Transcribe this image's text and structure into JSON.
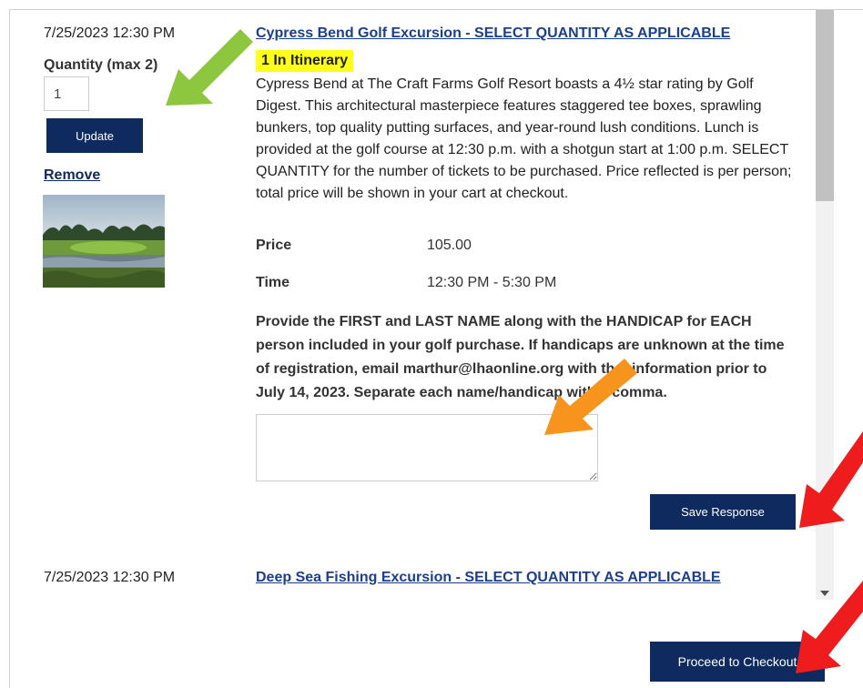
{
  "items": [
    {
      "datetime": "7/25/2023 12:30 PM",
      "quantity_label": "Quantity (max 2)",
      "quantity_value": "1",
      "update_label": "Update",
      "remove_label": "Remove",
      "title": "Cypress Bend Golf Excursion - SELECT QUANTITY AS APPLICABLE",
      "badge": "1 In Itinerary",
      "description": "Cypress Bend at The Craft Farms Golf Resort boasts a 4½ star rating by Golf Digest. This architectural masterpiece features staggered tee boxes, sprawling bunkers, top quality putting surfaces, and year-round lush conditions. Lunch is provided at the golf course at 12:30 p.m. with a shotgun start at 1:00 p.m. SELECT QUANTITY for the number of tickets to be purchased. Price reflected is per person; total price will be shown in your cart at checkout.",
      "price_label": "Price",
      "price_value": "105.00",
      "time_label": "Time",
      "time_value": "12:30 PM - 5:30 PM",
      "prompt": "Provide the FIRST and LAST NAME along with the HANDICAP for EACH person included in your golf purchase. If handicaps are unknown at the time of registration, email marthur@lhaonline.org with that information prior to July 14, 2023. Separate each name/handicap with a comma.",
      "response_value": "",
      "save_label": "Save Response"
    },
    {
      "datetime": "7/25/2023 12:30 PM",
      "title": "Deep Sea Fishing Excursion - SELECT QUANTITY AS APPLICABLE"
    }
  ],
  "checkout_label": "Proceed to Checkout",
  "colors": {
    "primary_button": "#0e2a5e",
    "link": "#1b3f8a",
    "badge": "#ffff1a",
    "arrow_green": "#8dc63f",
    "arrow_orange": "#f7941d",
    "arrow_red": "#ee1c1c"
  }
}
